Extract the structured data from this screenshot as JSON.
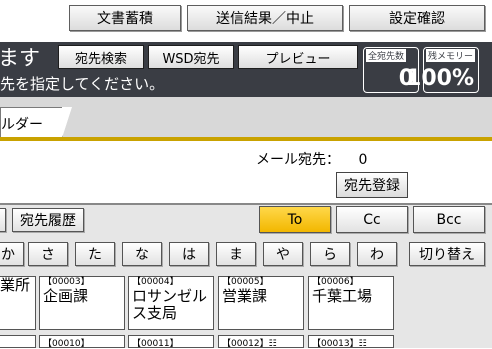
{
  "toolbar": {
    "stored_docs": "文書蓄積",
    "tx_result": "送信結果／中止",
    "settings_check": "設定確認"
  },
  "header": {
    "title": "ます",
    "subtitle": "先を指定してください。",
    "search_button": "宛先検索",
    "wsd_button": "WSD宛先",
    "preview_button": "プレビュー",
    "total_dest_label": "全宛先数",
    "total_dest_value": "0",
    "memory_label": "残メモリー",
    "memory_value": "100%"
  },
  "tabs": {
    "folder": "ルダー"
  },
  "panel": {
    "mail_label": "メール宛先：",
    "mail_count": "0",
    "register_button": "宛先登録"
  },
  "dest_row": {
    "history": "宛先履歴",
    "to": "To",
    "cc": "Cc",
    "bcc": "Bcc"
  },
  "kana": [
    "か",
    "さ",
    "た",
    "な",
    "は",
    "ま",
    "や",
    "ら",
    "わ"
  ],
  "switch_button": "切り替え",
  "cards": [
    {
      "no": "",
      "name": "業所"
    },
    {
      "no": "【00003】",
      "name": "企画課"
    },
    {
      "no": "【00004】",
      "name": "ロサンゼル",
      "name2": "ス支局"
    },
    {
      "no": "【00005】",
      "name": "営業課"
    },
    {
      "no": "【00006】",
      "name": "千葉工場"
    }
  ],
  "cards_row2": [
    "",
    "【00010】",
    "【00011】",
    "【00012】",
    "【00013】"
  ],
  "colors": {
    "header_dark": "#3a3d44",
    "accent_gold": "#c9a200",
    "active_yellow": "#f2b700"
  }
}
